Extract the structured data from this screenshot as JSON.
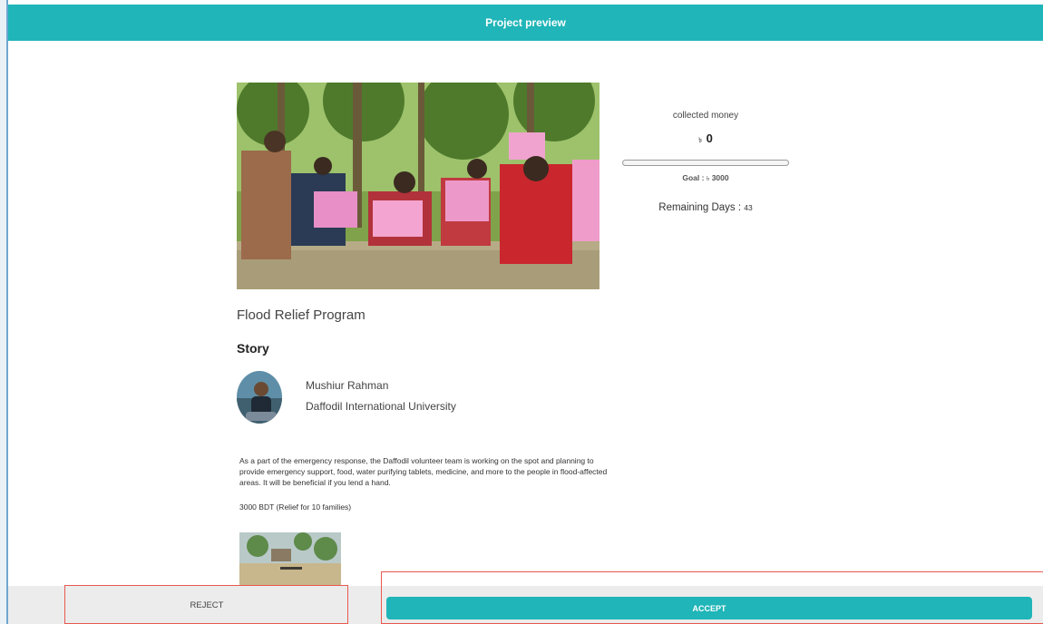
{
  "header": {
    "title": "Project preview"
  },
  "project": {
    "title": "Flood Relief Program",
    "story_heading": "Story",
    "author_name": "Mushiur Rahman",
    "author_org": "Daffodil International University",
    "story_text": "As a part of the emergency response, the Daffodil volunteer team is working on the spot and planning to provide emergency support, food, water purifying tablets, medicine, and more to the people in flood-affected areas. It will be beneficial if you lend a hand.",
    "story_amount": "3000 BDT (Relief for 10 families)"
  },
  "stats": {
    "collected_label": "collected money",
    "currency_symbol": "৳",
    "collected_amount": "0",
    "progress_fraction": 0,
    "goal_label": "Goal : ",
    "goal_amount": "3000",
    "remaining_label": "Remaining Days : ",
    "remaining_days": "43"
  },
  "actions": {
    "reject_label": "REJECT",
    "accept_label": "ACCEPT"
  },
  "colors": {
    "accent": "#20b5b8",
    "highlight_outline": "#e8594f",
    "footer_bg": "#ececec"
  }
}
